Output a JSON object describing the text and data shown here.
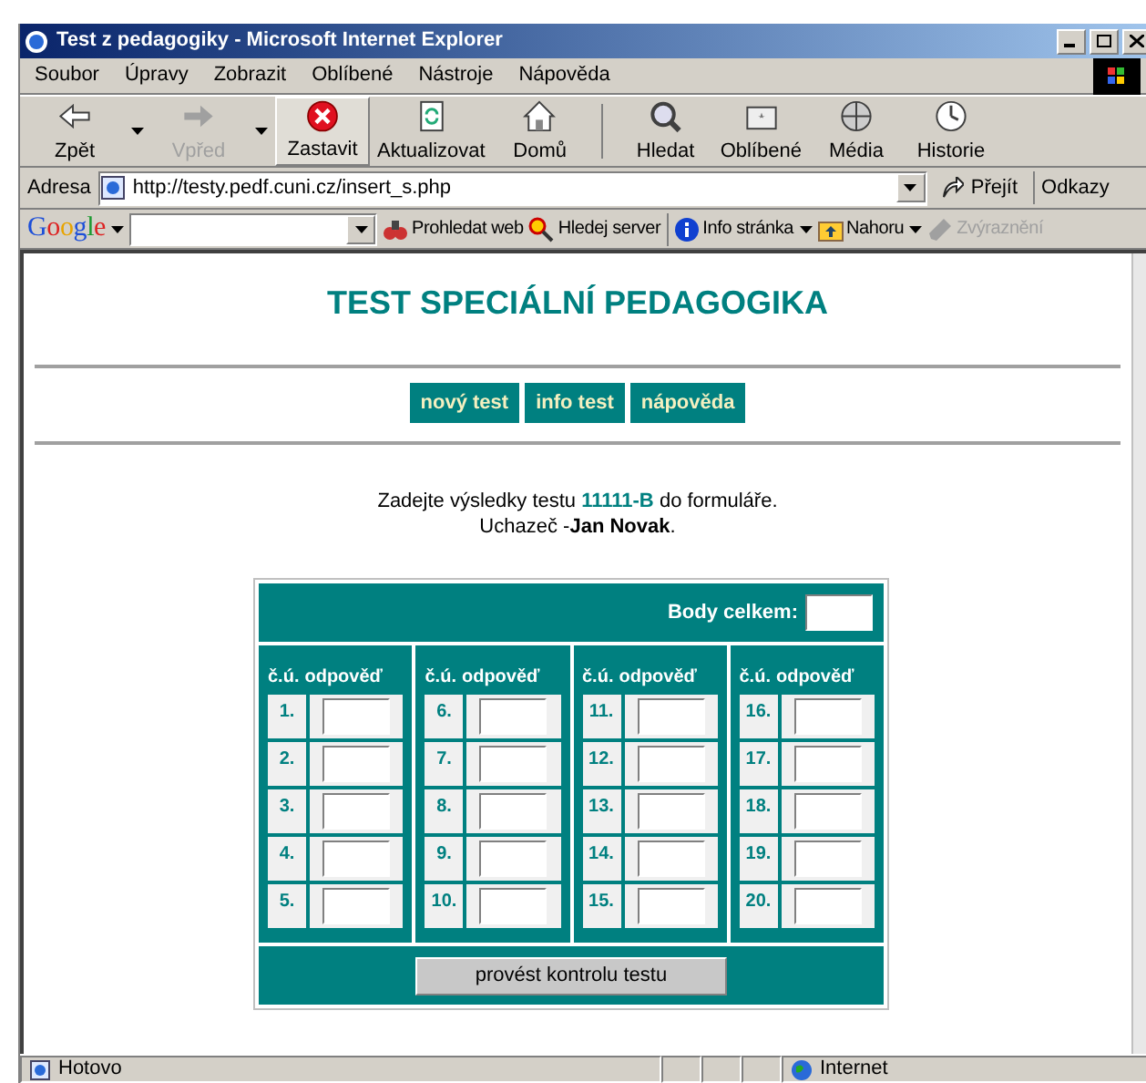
{
  "window": {
    "title": "Test z pedagogiky - Microsoft Internet Explorer"
  },
  "menu": [
    "Soubor",
    "Úpravy",
    "Zobrazit",
    "Oblíbené",
    "Nástroje",
    "Nápověda"
  ],
  "toolbar": [
    {
      "label": "Zpět",
      "kind": "back",
      "disabled": false,
      "dropdown": true
    },
    {
      "label": "Vpřed",
      "kind": "forward",
      "disabled": true,
      "dropdown": true
    },
    {
      "label": "Zastavit",
      "kind": "stop",
      "disabled": false,
      "dropdown": false
    },
    {
      "label": "Aktualizovat",
      "kind": "refresh",
      "disabled": false,
      "dropdown": false
    },
    {
      "label": "Domů",
      "kind": "home",
      "disabled": false,
      "dropdown": false
    },
    {
      "label": "Hledat",
      "kind": "search",
      "disabled": false,
      "dropdown": false
    },
    {
      "label": "Oblíbené",
      "kind": "favorites",
      "disabled": false,
      "dropdown": false
    },
    {
      "label": "Média",
      "kind": "media",
      "disabled": false,
      "dropdown": false
    },
    {
      "label": "Historie",
      "kind": "history",
      "disabled": false,
      "dropdown": false
    }
  ],
  "address": {
    "label": "Adresa",
    "value": "http://testy.pedf.cuni.cz/insert_s.php",
    "go": "Přejít",
    "links": "Odkazy"
  },
  "google_bar": {
    "logo": "Google",
    "items": [
      {
        "label": "Prohledat web",
        "kind": "binoculars",
        "disabled": false
      },
      {
        "label": "Hledej server",
        "kind": "search",
        "disabled": false
      },
      {
        "label": "Info stránka",
        "kind": "info",
        "disabled": false
      },
      {
        "label": "Nahoru",
        "kind": "folder",
        "disabled": false
      },
      {
        "label": "Zvýraznění",
        "kind": "marker",
        "disabled": true
      }
    ]
  },
  "page": {
    "heading": "TEST SPECIÁLNÍ PEDAGOGIKA",
    "nav": [
      "nový test",
      "info test",
      "nápověda"
    ],
    "intro": [
      "Zadejte výsledky testu **11111-B** do formuláře.",
      "Uchazeč -**Jan Novak**."
    ],
    "form": {
      "total_label": "Body celkem:",
      "groups": [
        {
          "number_header": "č.ú.",
          "answer_header": "odpověď",
          "questions": [
            "1.",
            "2.",
            "3.",
            "4.",
            "5."
          ]
        },
        {
          "number_header": "č.ú.",
          "answer_header": "odpověď",
          "questions": [
            "6.",
            "7.",
            "8.",
            "9.",
            "10."
          ]
        },
        {
          "number_header": "č.ú.",
          "answer_header": "odpověď",
          "questions": [
            "11.",
            "12.",
            "13.",
            "14.",
            "15."
          ]
        },
        {
          "number_header": "č.ú.",
          "answer_header": "odpověď",
          "questions": [
            "16.",
            "17.",
            "18.",
            "19.",
            "20."
          ]
        }
      ],
      "submit": "provést kontrolu testu"
    }
  },
  "status_bar": {
    "text": "Hotovo",
    "zone": "Internet"
  }
}
